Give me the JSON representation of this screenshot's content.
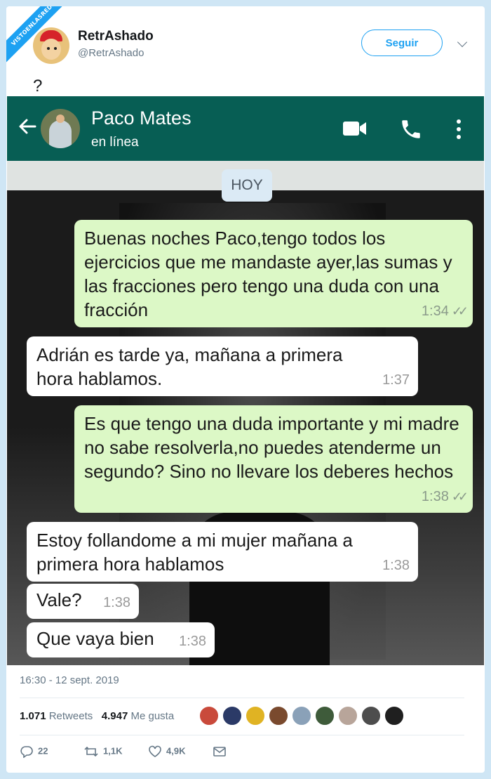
{
  "watermark": "VISTOENLASREDES",
  "tweet": {
    "display_name": "RetrAshado",
    "handle": "@RetrAshado",
    "follow_label": "Seguir",
    "text": "?"
  },
  "whatsapp": {
    "contact_name": "Paco Mates",
    "contact_status": "en línea",
    "date_chip": "HOY",
    "messages": [
      {
        "dir": "out",
        "text": "Buenas noches Paco,tengo todos los ejercicios que me mandaste ayer,las sumas y las fracciones pero tengo una duda con una fracción",
        "time": "1:34",
        "ticks": "✓✓"
      },
      {
        "dir": "in",
        "text": "Adrián es tarde ya, mañana a primera hora hablamos.",
        "time": "1:37"
      },
      {
        "dir": "out",
        "text": "Es que tengo una duda importante y mi madre no sabe resolverla,no puedes atenderme un segundo? Sino no llevare los deberes hechos",
        "time": "1:38",
        "ticks": "✓✓"
      },
      {
        "dir": "in",
        "text": "Estoy follandome a mi mujer mañana a primera hora hablamos",
        "time": "1:38"
      },
      {
        "dir": "in",
        "text": "Vale?",
        "time": "1:38"
      },
      {
        "dir": "in",
        "text": "Que vaya bien",
        "time": "1:38"
      }
    ]
  },
  "footer": {
    "timestamp": "16:30 - 12 sept. 2019",
    "retweets_count": "1.071",
    "retweets_label": "Retweets",
    "likes_count": "4.947",
    "likes_label": "Me gusta",
    "replies": "22",
    "retweets_short": "1,1K",
    "likes_short": "4,9K"
  },
  "colors": {
    "twitter_blue": "#1da1f2",
    "whatsapp_header": "#075e54",
    "outgoing_bubble": "#dcf8c6",
    "incoming_bubble": "#ffffff"
  }
}
